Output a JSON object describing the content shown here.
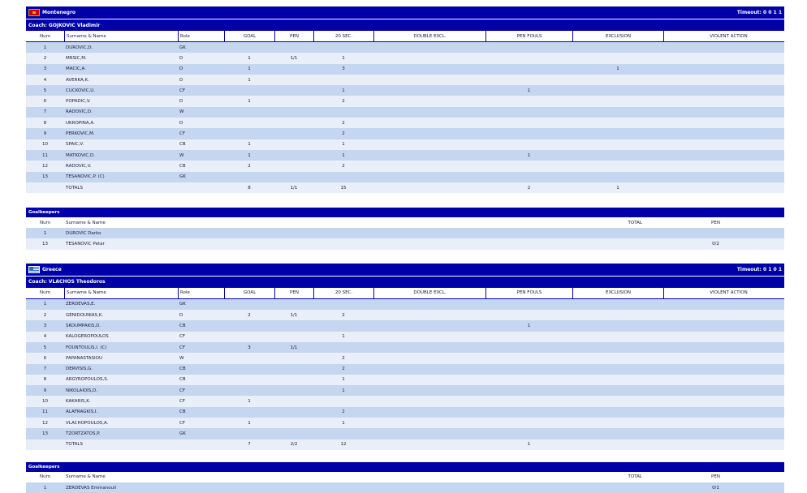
{
  "teams": [
    {
      "name": "Montenegro",
      "flag": "flag-montenegro",
      "timeout": "Timeout: 0  0  1  1",
      "coach": "Coach: GOJKOVIC Vladimir",
      "columns": [
        "Num",
        "Surname & Name",
        "Role",
        "GOAL",
        "PEN",
        "20 SEC.",
        "DOUBLE EXCL.",
        "PEN FOULS",
        "EXCLUSION",
        "VIOLENT ACTION"
      ],
      "players": [
        {
          "num": "1",
          "name": "DUROVIC,D.",
          "role": "GK",
          "goal": "",
          "pen": "",
          "sec20": "",
          "dexcl": "",
          "penfouls": "",
          "excl": "",
          "violent": ""
        },
        {
          "num": "2",
          "name": "MRSIC,M.",
          "role": "D",
          "goal": "1",
          "pen": "1/1",
          "sec20": "1",
          "dexcl": "",
          "penfouls": "",
          "excl": "",
          "violent": ""
        },
        {
          "num": "3",
          "name": "MACIC,A.",
          "role": "D",
          "goal": "1",
          "pen": "",
          "sec20": "3",
          "dexcl": "",
          "penfouls": "",
          "excl": "1",
          "violent": ""
        },
        {
          "num": "4",
          "name": "AVERKA,K.",
          "role": "D",
          "goal": "1",
          "pen": "",
          "sec20": "",
          "dexcl": "",
          "penfouls": "",
          "excl": "",
          "violent": ""
        },
        {
          "num": "5",
          "name": "CUCKOVIC,U.",
          "role": "CF",
          "goal": "",
          "pen": "",
          "sec20": "1",
          "dexcl": "",
          "penfouls": "1",
          "excl": "",
          "violent": ""
        },
        {
          "num": "6",
          "name": "POPADIC,V.",
          "role": "D",
          "goal": "1",
          "pen": "",
          "sec20": "2",
          "dexcl": "",
          "penfouls": "",
          "excl": "",
          "violent": ""
        },
        {
          "num": "7",
          "name": "RADOVIC,D.",
          "role": "W",
          "goal": "",
          "pen": "",
          "sec20": "",
          "dexcl": "",
          "penfouls": "",
          "excl": "",
          "violent": ""
        },
        {
          "num": "8",
          "name": "UKROPINA,A.",
          "role": "D",
          "goal": "",
          "pen": "",
          "sec20": "2",
          "dexcl": "",
          "penfouls": "",
          "excl": "",
          "violent": ""
        },
        {
          "num": "9",
          "name": "PERKOVIC,M.",
          "role": "CF",
          "goal": "",
          "pen": "",
          "sec20": "2",
          "dexcl": "",
          "penfouls": "",
          "excl": "",
          "violent": ""
        },
        {
          "num": "10",
          "name": "SPAIC,V.",
          "role": "CB",
          "goal": "1",
          "pen": "",
          "sec20": "1",
          "dexcl": "",
          "penfouls": "",
          "excl": "",
          "violent": ""
        },
        {
          "num": "11",
          "name": "MATKOVIC,D.",
          "role": "W",
          "goal": "1",
          "pen": "",
          "sec20": "1",
          "dexcl": "",
          "penfouls": "1",
          "excl": "",
          "violent": ""
        },
        {
          "num": "12",
          "name": "RADOVIC,V.",
          "role": "CB",
          "goal": "2",
          "pen": "",
          "sec20": "2",
          "dexcl": "",
          "penfouls": "",
          "excl": "",
          "violent": ""
        },
        {
          "num": "13",
          "name": "TESANOVIC,P. (C)",
          "role": "GK",
          "goal": "",
          "pen": "",
          "sec20": "",
          "dexcl": "",
          "penfouls": "",
          "excl": "",
          "violent": ""
        },
        {
          "num": "",
          "name": "TOTALS",
          "role": "",
          "goal": "8",
          "pen": "1/1",
          "sec20": "15",
          "dexcl": "",
          "penfouls": "2",
          "excl": "1",
          "violent": ""
        }
      ],
      "goalkeepers_title": "Goalkeepers",
      "gk_columns": [
        "Num",
        "Surname & Name",
        "TOTAL",
        "PEN"
      ],
      "goalkeepers": [
        {
          "num": "1",
          "name": "DUROVIC Darko",
          "total": "",
          "pen": ""
        },
        {
          "num": "13",
          "name": "TESANOVIC Petar",
          "total": "",
          "pen": "0/2"
        }
      ]
    },
    {
      "name": "Greece",
      "flag": "flag-greece",
      "timeout": "Timeout: 0  1  0  1",
      "coach": "Coach: VLACHOS Theodoros",
      "columns": [
        "Num",
        "Surname & Name",
        "Role",
        "GOAL",
        "PEN",
        "20 SEC.",
        "DOUBLE EXCL.",
        "PEN FOULS",
        "EXCLUSION",
        "VIOLENT ACTION"
      ],
      "players": [
        {
          "num": "1",
          "name": "ZERDEVAS,E.",
          "role": "GK",
          "goal": "",
          "pen": "",
          "sec20": "",
          "dexcl": "",
          "penfouls": "",
          "excl": "",
          "violent": ""
        },
        {
          "num": "2",
          "name": "GENIDOUNIAS,K.",
          "role": "D",
          "goal": "2",
          "pen": "1/1",
          "sec20": "2",
          "dexcl": "",
          "penfouls": "",
          "excl": "",
          "violent": ""
        },
        {
          "num": "3",
          "name": "SKOUMPAKIS,D.",
          "role": "CB",
          "goal": "",
          "pen": "",
          "sec20": "",
          "dexcl": "",
          "penfouls": "1",
          "excl": "",
          "violent": ""
        },
        {
          "num": "4",
          "name": "KALOGEROPOULOS",
          "role": "CF",
          "goal": "",
          "pen": "",
          "sec20": "1",
          "dexcl": "",
          "penfouls": "",
          "excl": "",
          "violent": ""
        },
        {
          "num": "5",
          "name": "FOUNTOULIS,I. (C)",
          "role": "CF",
          "goal": "3",
          "pen": "1/1",
          "sec20": "",
          "dexcl": "",
          "penfouls": "",
          "excl": "",
          "violent": ""
        },
        {
          "num": "6",
          "name": "PAPANASTASIOU",
          "role": "W",
          "goal": "",
          "pen": "",
          "sec20": "2",
          "dexcl": "",
          "penfouls": "",
          "excl": "",
          "violent": ""
        },
        {
          "num": "7",
          "name": "DERVISIS,G.",
          "role": "CB",
          "goal": "",
          "pen": "",
          "sec20": "2",
          "dexcl": "",
          "penfouls": "",
          "excl": "",
          "violent": ""
        },
        {
          "num": "8",
          "name": "ARGYROPOULOS,S.",
          "role": "CB",
          "goal": "",
          "pen": "",
          "sec20": "1",
          "dexcl": "",
          "penfouls": "",
          "excl": "",
          "violent": ""
        },
        {
          "num": "9",
          "name": "NIKOLAIDIS,D.",
          "role": "CF",
          "goal": "",
          "pen": "",
          "sec20": "1",
          "dexcl": "",
          "penfouls": "",
          "excl": "",
          "violent": ""
        },
        {
          "num": "10",
          "name": "KAKARIS,K.",
          "role": "CF",
          "goal": "1",
          "pen": "",
          "sec20": "",
          "dexcl": "",
          "penfouls": "",
          "excl": "",
          "violent": ""
        },
        {
          "num": "11",
          "name": "ALAFRAGKIS,I.",
          "role": "CB",
          "goal": "",
          "pen": "",
          "sec20": "2",
          "dexcl": "",
          "penfouls": "",
          "excl": "",
          "violent": ""
        },
        {
          "num": "12",
          "name": "VLACHOPOULOS,A.",
          "role": "CF",
          "goal": "1",
          "pen": "",
          "sec20": "1",
          "dexcl": "",
          "penfouls": "",
          "excl": "",
          "violent": ""
        },
        {
          "num": "13",
          "name": "TZORTZATOS,P.",
          "role": "GK",
          "goal": "",
          "pen": "",
          "sec20": "",
          "dexcl": "",
          "penfouls": "",
          "excl": "",
          "violent": ""
        },
        {
          "num": "",
          "name": "TOTALS",
          "role": "",
          "goal": "7",
          "pen": "2/2",
          "sec20": "12",
          "dexcl": "",
          "penfouls": "1",
          "excl": "",
          "violent": ""
        }
      ],
      "goalkeepers_title": "Goalkeepers",
      "gk_columns": [
        "Num",
        "Surname & Name",
        "TOTAL",
        "PEN"
      ],
      "goalkeepers": [
        {
          "num": "1",
          "name": "ZERDEVAS Emmanouil",
          "total": "",
          "pen": "0/1"
        }
      ]
    }
  ]
}
